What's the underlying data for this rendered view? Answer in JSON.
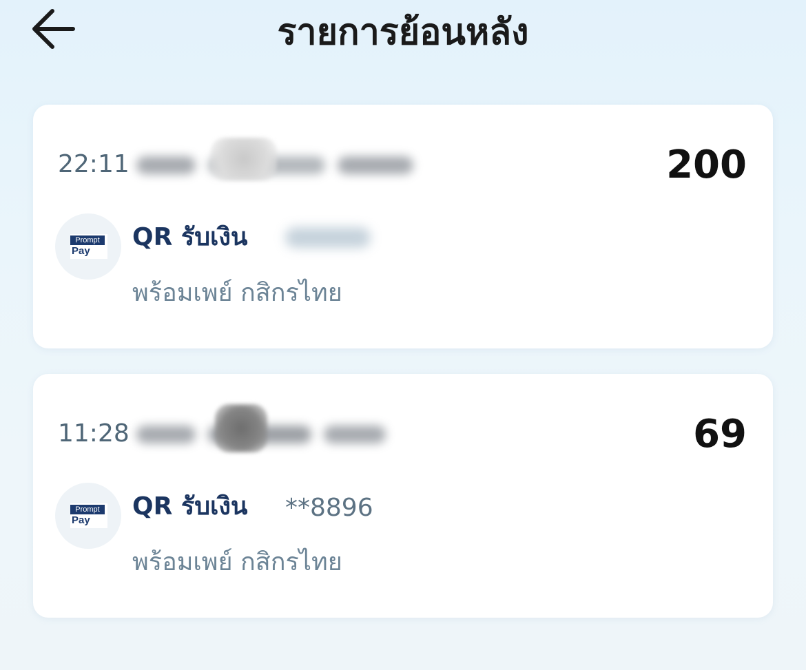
{
  "header": {
    "title": "รายการย้อนหลัง",
    "back_icon": "arrow-left-icon"
  },
  "transactions": [
    {
      "time": "22:11",
      "amount": "200",
      "type_label": "QR รับเงิน",
      "account": "",
      "provider": "พร้อมเพย์ กสิกรไทย",
      "logo": {
        "top": "Prompt",
        "bottom": "Pay"
      }
    },
    {
      "time": "11:28",
      "amount": "69",
      "type_label": "QR รับเงิน",
      "account": "**8896",
      "provider": "พร้อมเพย์ กสิกรไทย",
      "logo": {
        "top": "Prompt",
        "bottom": "Pay"
      }
    }
  ],
  "colors": {
    "title": "#1a1a1a",
    "type_label": "#1b3560",
    "secondary_text": "#6c8496",
    "card_bg": "#ffffff",
    "logo_brand": "#1c3a6e"
  }
}
